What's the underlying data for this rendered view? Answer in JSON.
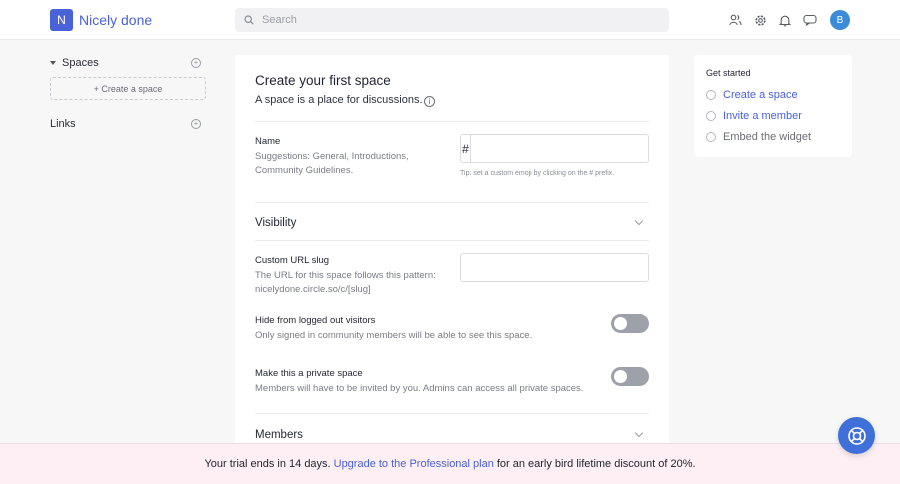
{
  "header": {
    "logo_letter": "N",
    "brand": "Nicely done",
    "search_placeholder": "Search",
    "avatar_letter": "B"
  },
  "sidebar": {
    "spaces_title": "Spaces",
    "create_space": "+ Create a space",
    "links_title": "Links"
  },
  "main": {
    "title": "Create your first space",
    "subtitle": "A space is a place for discussions.",
    "name_label": "Name",
    "name_hint": "Suggestions: General, Introductions, Community Guidelines.",
    "hash_prefix": "#",
    "tip": "Tip: set a custom emoji by clicking on the # prefix.",
    "visibility": "Visibility",
    "slug_label": "Custom URL slug",
    "slug_hint": "The URL for this space follows this pattern: nicelydone.circle.so/c/[slug]",
    "hide_label": "Hide from logged out visitors",
    "hide_hint": "Only signed in community members will be able to see this space.",
    "private_label": "Make this a private space",
    "private_hint": "Members will have to be invited by you. Admins can access all private spaces.",
    "members": "Members"
  },
  "get_started": {
    "title": "Get started",
    "items": [
      {
        "label": "Create a space"
      },
      {
        "label": "Invite a member"
      },
      {
        "label": "Embed the widget"
      }
    ]
  },
  "banner": {
    "prefix": "Your trial ends in 14 days.",
    "link": "Upgrade to the Professional plan",
    "suffix": "for an early bird lifetime discount of 20%."
  },
  "colors": {
    "accent": "#4a62d8",
    "banner_bg": "#fdeff4",
    "toggle_off": "#9ea1a9"
  },
  "icons": [
    "search-icon",
    "members-icon",
    "gear-icon",
    "bell-icon",
    "chat-icon",
    "plus-circle-icon",
    "info-icon",
    "chevron-down-icon",
    "lifebuoy-icon"
  ]
}
